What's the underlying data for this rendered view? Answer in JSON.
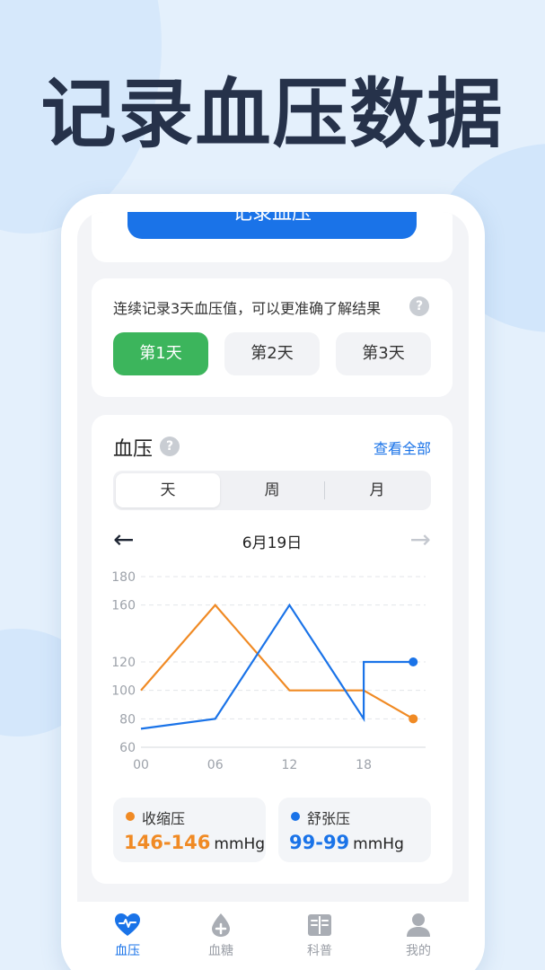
{
  "headline": "记录血压数据",
  "record_button": "记录血压",
  "days": {
    "note": "连续记录3天血压值，可以更准确了解结果",
    "help": "?",
    "buttons": [
      "第1天",
      "第2天",
      "第3天"
    ],
    "active_index": 0
  },
  "bp_card": {
    "title": "血压",
    "help": "?",
    "view_all": "查看全部",
    "segments": [
      "天",
      "周",
      "月"
    ],
    "active_segment": 0,
    "prev_arrow": "←",
    "next_arrow": "→",
    "date": "6月19日"
  },
  "chart_data": {
    "type": "line",
    "x_ticks": [
      "00",
      "06",
      "12",
      "18"
    ],
    "ylim": [
      60,
      180
    ],
    "y_ticks": [
      60,
      80,
      100,
      120,
      160,
      180
    ],
    "grid": true,
    "series": [
      {
        "name": "收缩压",
        "color": "#f08a24",
        "points": [
          [
            0,
            100
          ],
          [
            6,
            160
          ],
          [
            12,
            100
          ],
          [
            18,
            100
          ],
          [
            22,
            80
          ]
        ]
      },
      {
        "name": "舒张压",
        "color": "#1a73e8",
        "points": [
          [
            0,
            73
          ],
          [
            6,
            80
          ],
          [
            12,
            160
          ],
          [
            18,
            80
          ],
          [
            18,
            120
          ],
          [
            22,
            120
          ]
        ]
      }
    ]
  },
  "legend": [
    {
      "name": "收缩压",
      "value": "146-146",
      "unit": "mmHg",
      "color": "#f08a24"
    },
    {
      "name": "舒张压",
      "value": "99-99",
      "unit": "mmHg",
      "color": "#1a73e8"
    }
  ],
  "tabbar": {
    "items": [
      {
        "label": "血压",
        "icon": "heart-pulse-icon"
      },
      {
        "label": "血糖",
        "icon": "blood-drop-plus-icon"
      },
      {
        "label": "科普",
        "icon": "book-icon"
      },
      {
        "label": "我的",
        "icon": "user-icon"
      }
    ],
    "active_index": 0,
    "active_color": "#1a73e8",
    "inactive_color": "#9a9ea6"
  }
}
